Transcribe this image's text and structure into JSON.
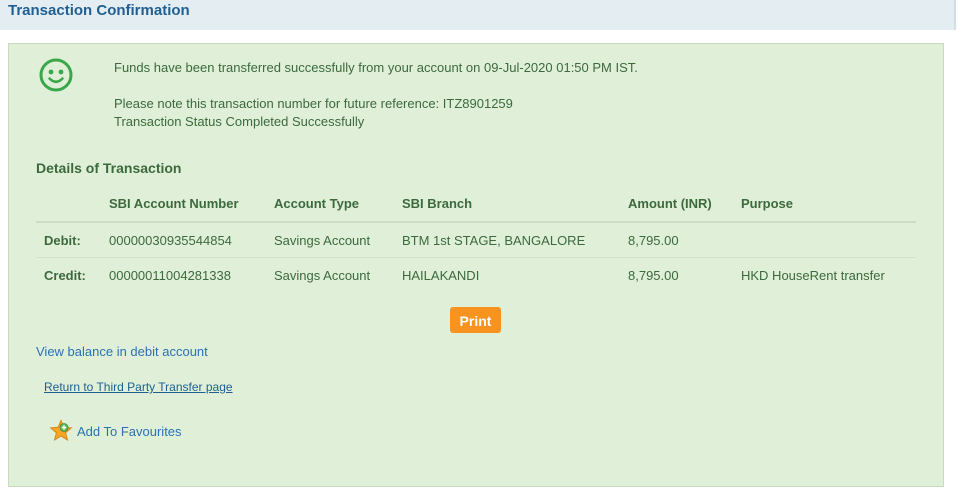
{
  "header": {
    "title": "Transaction Confirmation"
  },
  "confirmation": {
    "status_icon": "smiley-icon",
    "success_message": "Funds have been transferred successfully from your account on 09-Jul-2020 01:50 PM IST.",
    "reference_note": "Please note this transaction number for future reference: ITZ8901259",
    "status_text": "Transaction Status Completed Successfully"
  },
  "details": {
    "section_title": "Details of Transaction",
    "columns": [
      "",
      "SBI Account Number",
      "Account Type",
      "SBI Branch",
      "Amount (INR)",
      "Purpose"
    ],
    "rows": [
      {
        "label": "Debit:",
        "account_number": "00000030935544854",
        "account_type": "Savings Account",
        "branch": "BTM 1st STAGE, BANGALORE",
        "amount": "8,795.00",
        "purpose": ""
      },
      {
        "label": "Credit:",
        "account_number": "00000011004281338",
        "account_type": "Savings Account",
        "branch": "HAILAKANDI",
        "amount": "8,795.00",
        "purpose": "HKD HouseRent transfer"
      }
    ]
  },
  "actions": {
    "print_label": "Print",
    "view_balance_label": "View balance in debit account",
    "return_label": "Return to Third Party Transfer page",
    "favourites_label": "Add To Favourites",
    "favourites_icon": "star-add-icon"
  },
  "colors": {
    "title": "#1f5f93",
    "panel_bg": "#dfefd8",
    "text_green": "#3c6a3c",
    "link_blue": "#2a72b4",
    "print_orange": "#f7931e",
    "smiley_green": "#3aa84a"
  }
}
